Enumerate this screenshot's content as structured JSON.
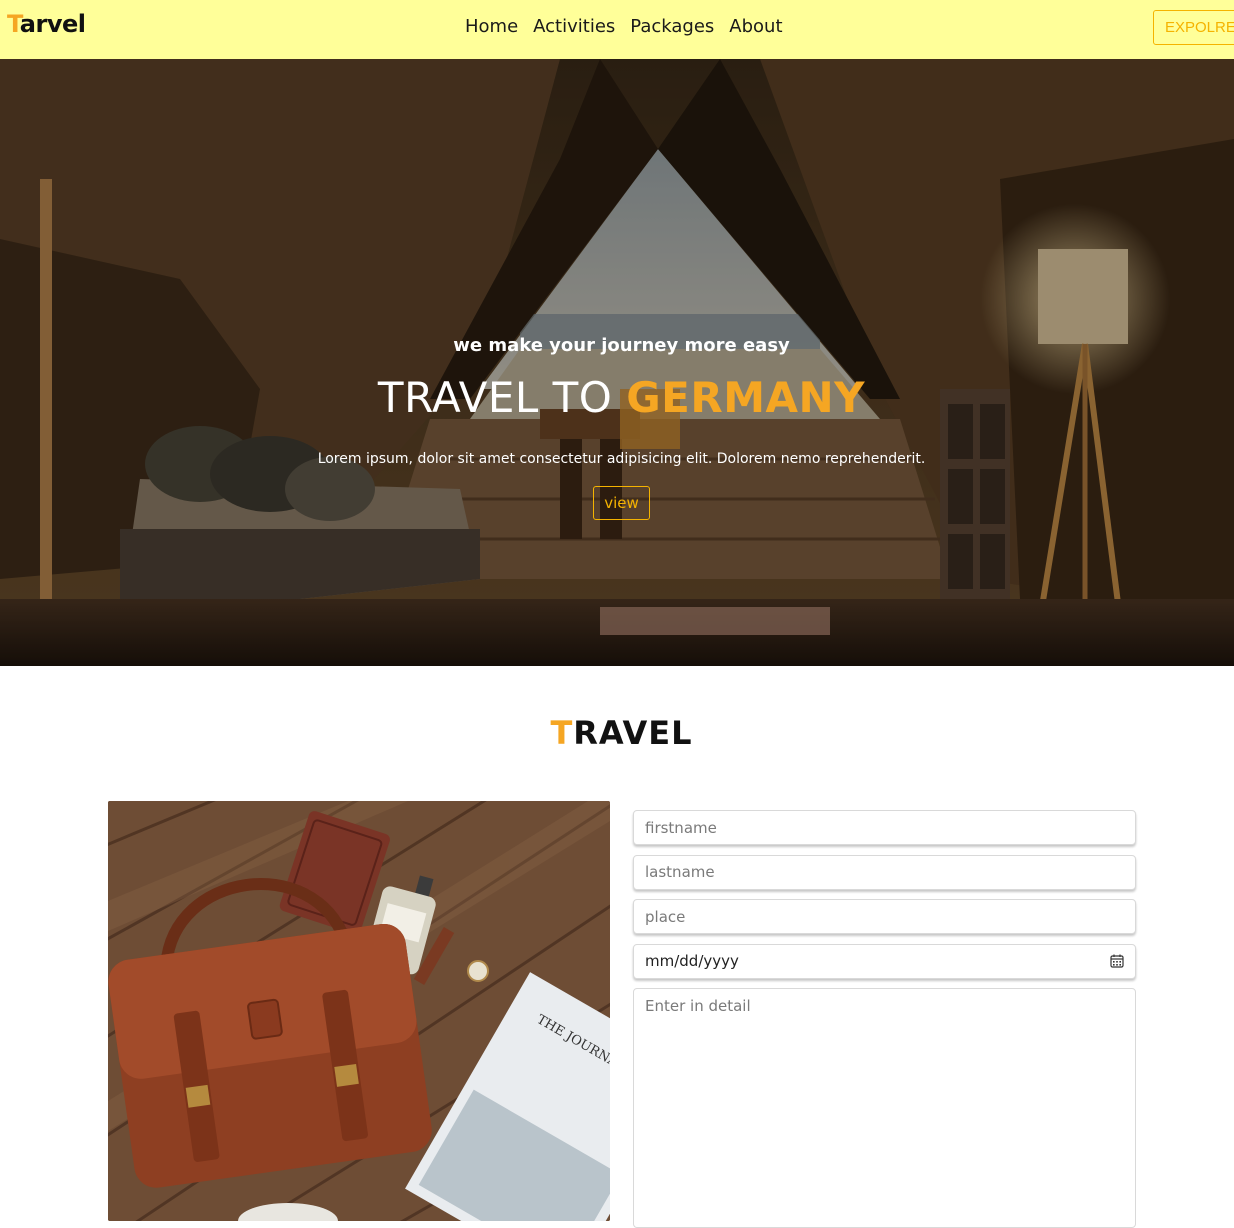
{
  "navbar": {
    "logo_first": "T",
    "logo_rest": "arvel",
    "links": [
      "Home",
      "Activities",
      "Packages",
      "About"
    ],
    "explore_label": "EXPOLRE"
  },
  "hero": {
    "subtitle": "we make your journey more easy",
    "title_prefix": "TRAVEL TO ",
    "title_highlight": "GERMANY",
    "description": "Lorem ipsum, dolor sit amet consectetur adipisicing elit. Dolorem nemo reprehenderit.",
    "view_label": "view"
  },
  "section": {
    "title_first": "T",
    "title_rest": "RAVEL"
  },
  "photo": {
    "magazine_text": "THE JOURNAL"
  },
  "form": {
    "firstname_placeholder": "firstname",
    "lastname_placeholder": "lastname",
    "place_placeholder": "place",
    "date_placeholder": "mm/dd/yyyy",
    "detail_placeholder": "Enter in detail"
  },
  "colors": {
    "navbar_bg": "#ffff99",
    "accent": "#f5a623",
    "button_border": "#f5b300"
  }
}
